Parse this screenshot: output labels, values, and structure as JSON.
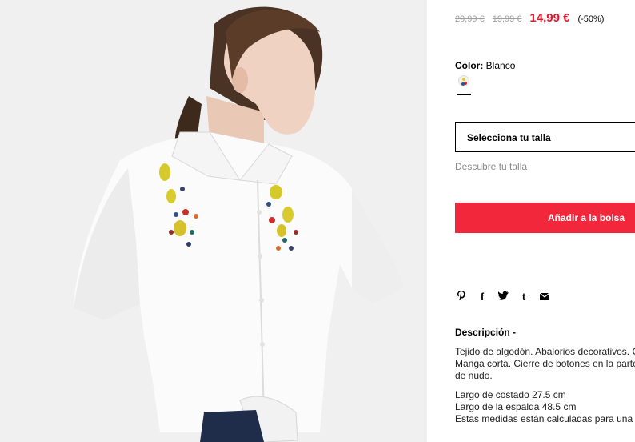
{
  "pricing": {
    "original_price": "29,99 €",
    "previous_price": "19,99 €",
    "current_price": "14,99 €",
    "discount": "(-50%)"
  },
  "color": {
    "label": "Color:",
    "value": "Blanco"
  },
  "size": {
    "select_label": "Selecciona tu talla",
    "guide_link": "Descubre tu talla"
  },
  "actions": {
    "add_to_bag": "Añadir a la bolsa"
  },
  "share": {
    "pinterest": "𝗣",
    "facebook": "f",
    "twitter": "🐦",
    "tumblr": "t",
    "email": "✉"
  },
  "description": {
    "title": "Descripción -",
    "lines": [
      "Tejido de algodón. Abalorios decorativos. C",
      "Manga corta. Cierre de botones en la parte",
      "de nudo.",
      "Largo de costado 27.5 cm",
      "Largo de la espalda 48.5 cm",
      "Estas medidas están calculadas para una t"
    ]
  },
  "colors": {
    "sale_red": "#e4152b",
    "button_red": "#f2273c",
    "muted_gray": "#9e9e9e"
  }
}
